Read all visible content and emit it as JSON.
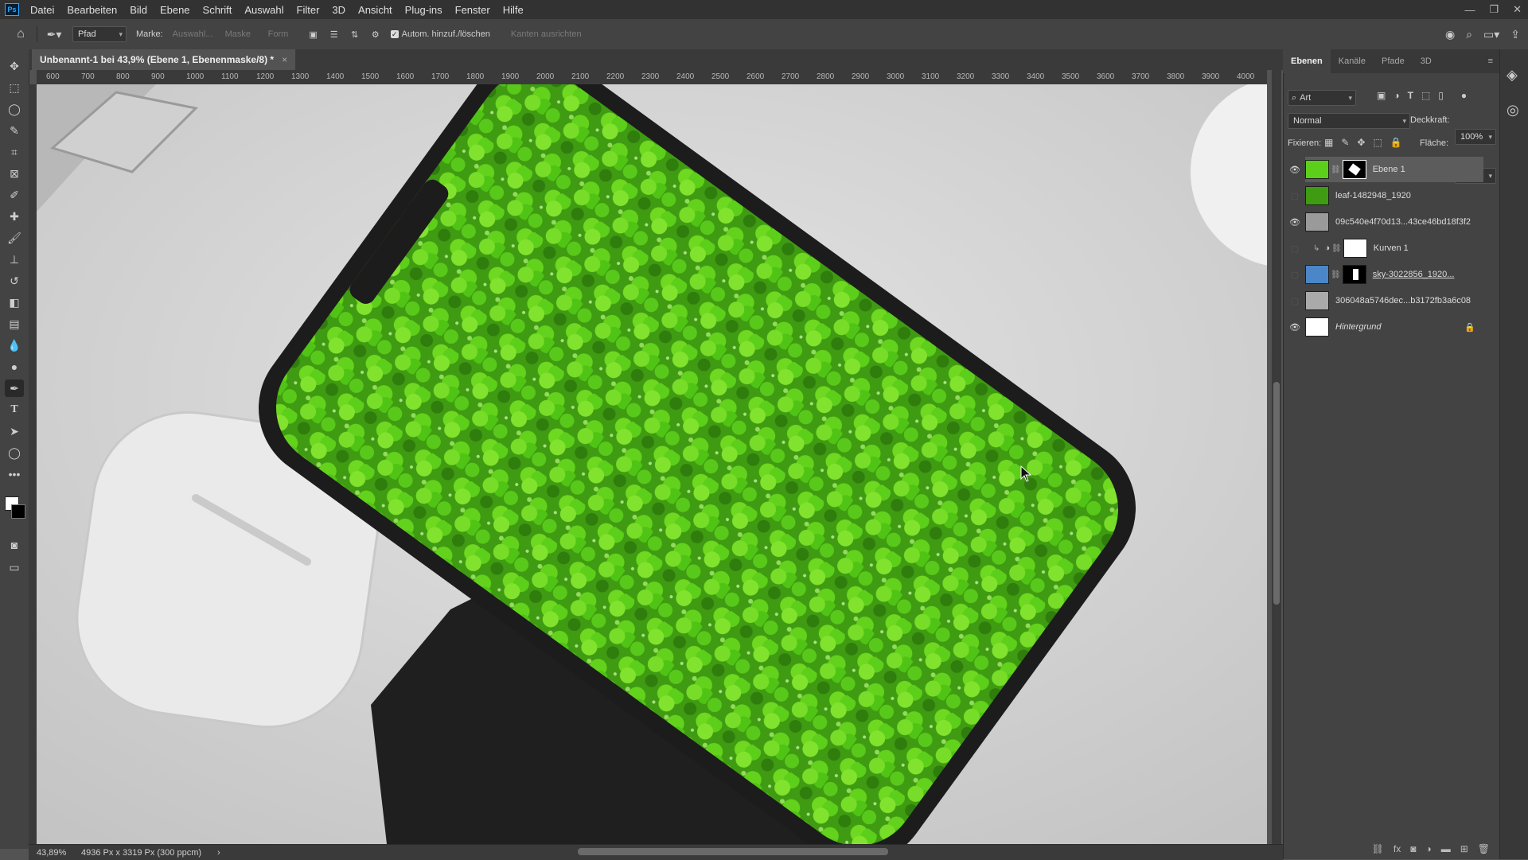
{
  "menu": {
    "logo": "Ps",
    "items": [
      "Datei",
      "Bearbeiten",
      "Bild",
      "Ebene",
      "Schrift",
      "Auswahl",
      "Filter",
      "3D",
      "Ansicht",
      "Plug-ins",
      "Fenster",
      "Hilfe"
    ]
  },
  "options": {
    "mode": "Pfad",
    "make_label": "Marke:",
    "selection": "Auswahl...",
    "mask": "Maske",
    "shape": "Form",
    "auto_add_label": "Autom. hinzuf./löschen",
    "auto_add_checked": true,
    "align_edges": "Kanten ausrichten"
  },
  "document": {
    "tab_title": "Unbenannt-1 bei 43,9% (Ebene 1, Ebenenmaske/8) *",
    "close": "×"
  },
  "ruler": {
    "h_ticks": [
      "600",
      "700",
      "800",
      "900",
      "1000",
      "1100",
      "1200",
      "1300",
      "1400",
      "1500",
      "1600",
      "1700",
      "1800",
      "1900",
      "2000",
      "2100",
      "2200",
      "2300",
      "2400",
      "2500",
      "2600",
      "2700",
      "2800",
      "2900",
      "3000",
      "3100",
      "3200",
      "3300",
      "3400",
      "3500",
      "3600",
      "3700",
      "3800",
      "3900",
      "4000"
    ]
  },
  "status": {
    "zoom": "43,89%",
    "dimensions": "4936 Px x 3319 Px (300 ppcm)",
    "arrow": "›"
  },
  "layers_panel": {
    "tabs": [
      "Ebenen",
      "Kanäle",
      "Pfade",
      "3D"
    ],
    "active_tab": "Ebenen",
    "filter_kind": "Art",
    "blend_mode": "Normal",
    "opacity_label": "Deckkraft:",
    "opacity": "100%",
    "lock_label": "Fixieren:",
    "fill_label": "Fläche:",
    "fill": "100%",
    "layers": [
      {
        "name": "Ebene 1",
        "visible": true,
        "selected": true,
        "mask": true
      },
      {
        "name": "leaf-1482948_1920",
        "visible": false,
        "selected": false,
        "mask": false
      },
      {
        "name": "09c540e4f70d13...43ce46bd18f3f2",
        "visible": true,
        "selected": false,
        "mask": false
      },
      {
        "name": "Kurven 1",
        "visible": false,
        "selected": false,
        "mask": true
      },
      {
        "name": "sky-3022856_1920...",
        "visible": false,
        "selected": false,
        "mask": true
      },
      {
        "name": "306048a5746dec...b3172fb3a6c08",
        "visible": false,
        "selected": false,
        "mask": false
      },
      {
        "name": "Hintergrund",
        "visible": true,
        "selected": false,
        "mask": false,
        "locked": true
      }
    ]
  },
  "colors": {
    "accent": "#31a8ff",
    "clover_green": "#5ccf1a",
    "phone_body": "#222222"
  }
}
